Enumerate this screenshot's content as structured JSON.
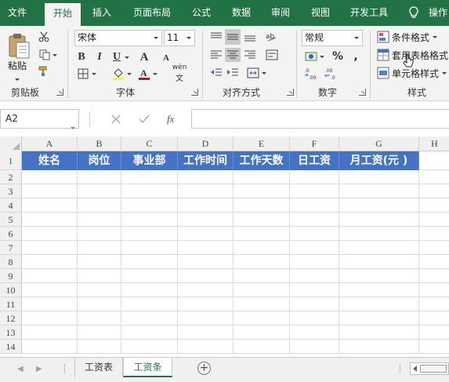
{
  "colors": {
    "brand": "#217346",
    "header_fill": "#4472c4",
    "header_text": "#ffffff",
    "ribbon_bg": "#f3f3f3"
  },
  "menu": {
    "tabs": [
      "文件",
      "开始",
      "插入",
      "页面布局",
      "公式",
      "数据",
      "审阅",
      "视图",
      "开发工具"
    ],
    "active": "开始",
    "help_icon": "lightbulb-icon",
    "last_tab": "操作"
  },
  "ribbon": {
    "clipboard": {
      "label": "剪贴板",
      "paste_label": "粘贴"
    },
    "font": {
      "label": "字体",
      "font_name": "宋体",
      "font_size": "11",
      "bold": "B",
      "italic": "I",
      "underline": "U",
      "grow": "A",
      "shrink": "A",
      "phonetic": "wén"
    },
    "alignment": {
      "label": "对齐方式"
    },
    "number": {
      "label": "数字",
      "format": "常规",
      "percent": "%"
    },
    "styles": {
      "label": "样式",
      "items": [
        "条件格式",
        "套用表格格式",
        "单元格样式"
      ]
    }
  },
  "formula_bar": {
    "name_box": "A2",
    "formula": "",
    "cancel_icon": "close-icon",
    "enter_icon": "check-icon",
    "fx_label": "fx"
  },
  "sheet": {
    "columns": [
      "A",
      "B",
      "C",
      "D",
      "E",
      "F",
      "G",
      "H"
    ],
    "rows": [
      "1",
      "2",
      "3",
      "4",
      "5",
      "6",
      "7",
      "8",
      "9",
      "10",
      "11",
      "12",
      "13",
      "14"
    ],
    "header_row": [
      "姓名",
      "岗位",
      "事业部",
      "工作时间",
      "工作天数",
      "日工资",
      "月工资(元 )"
    ],
    "selected_row": "1"
  },
  "sheet_tabs": {
    "tabs": [
      "工资表",
      "工资条"
    ],
    "active": "工资条",
    "add_label": "+"
  }
}
